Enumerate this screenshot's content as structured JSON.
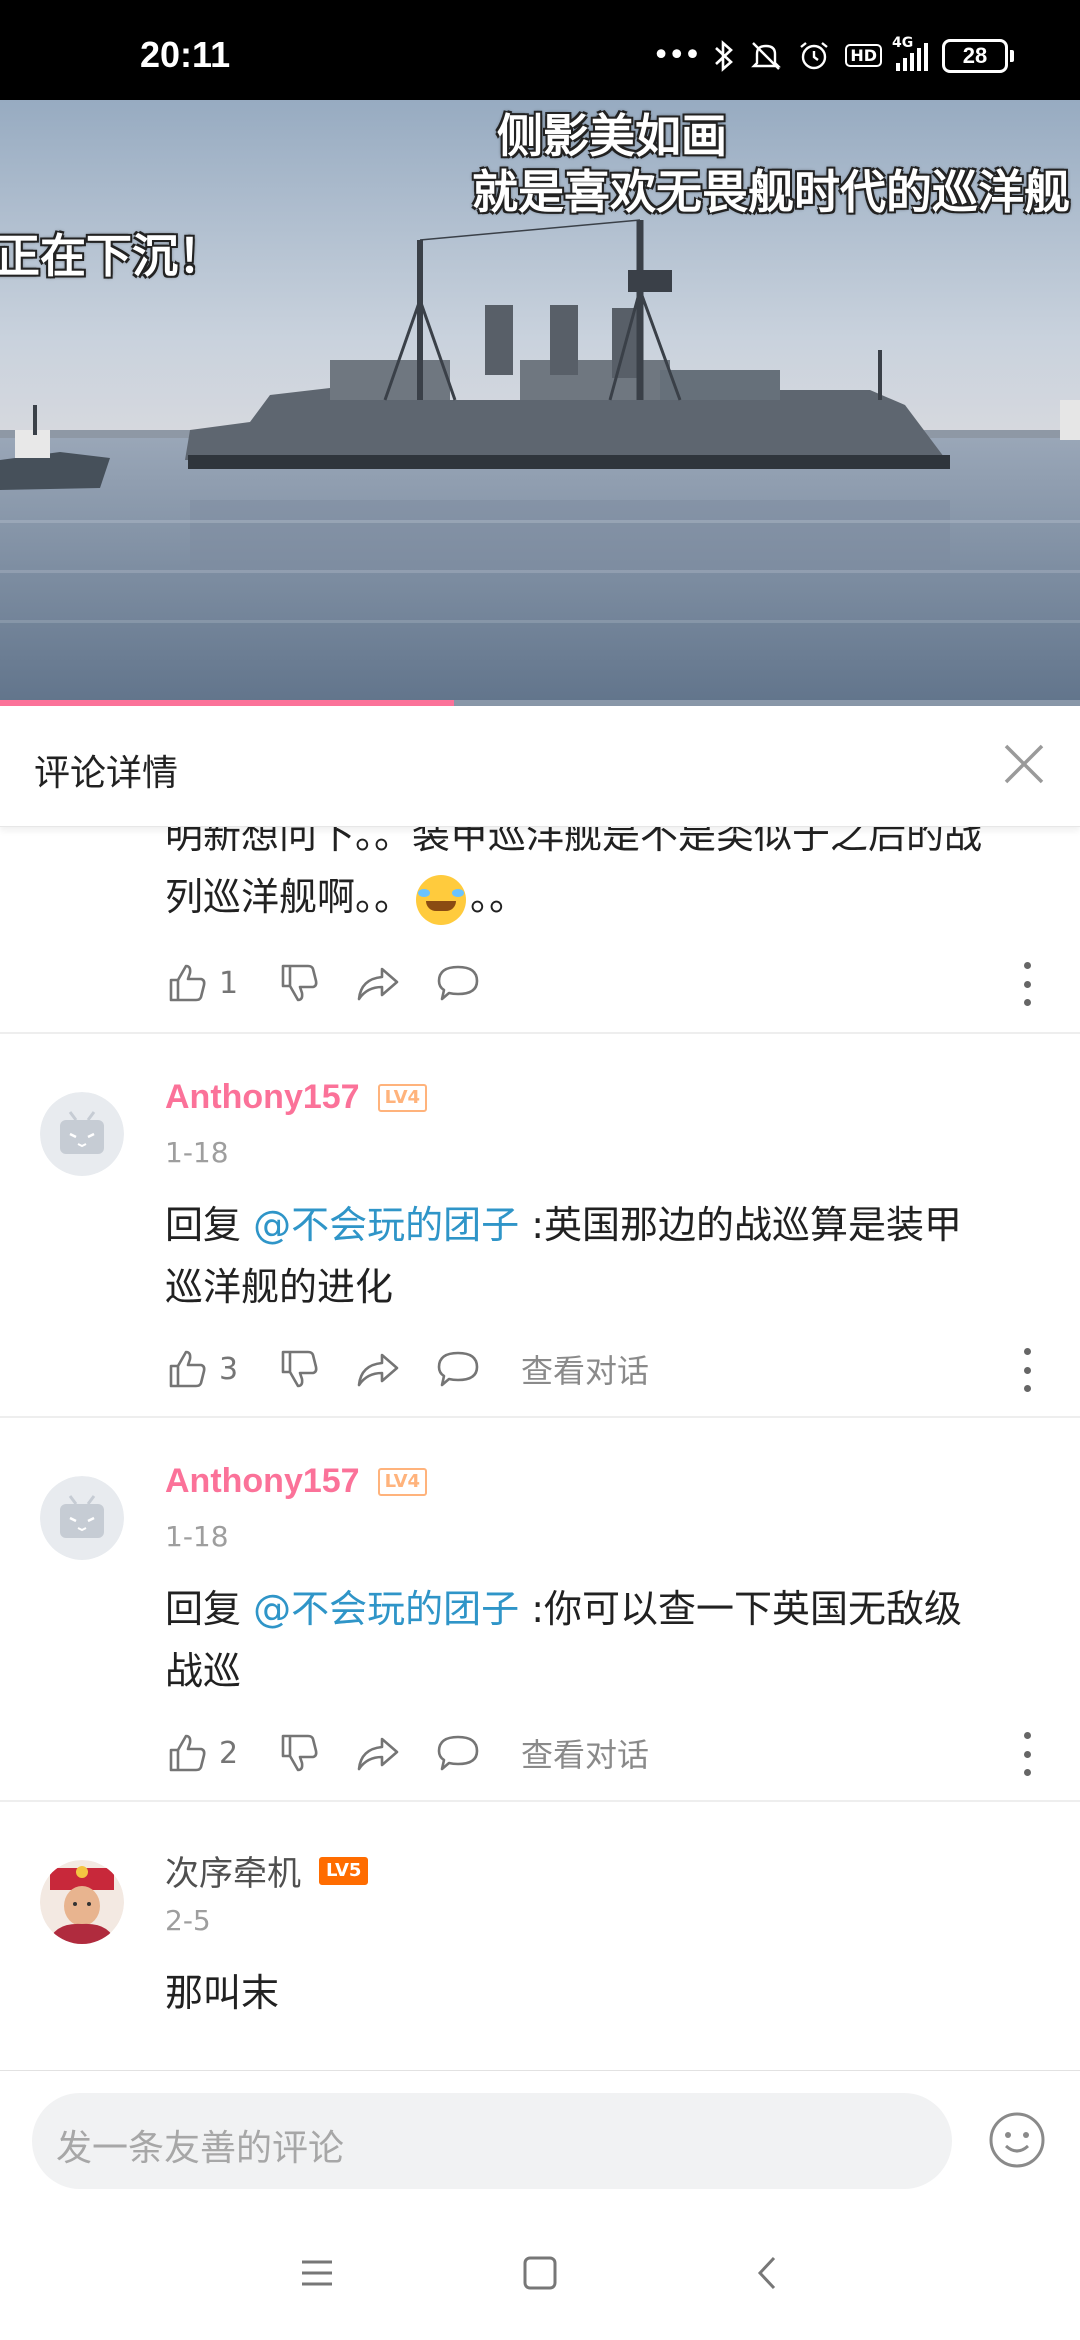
{
  "status_bar": {
    "time": "20:11",
    "network": "4G",
    "hd_badge": "HD",
    "battery": "28",
    "icons": [
      "more-dots-icon",
      "bluetooth-icon",
      "mute-bell-icon",
      "alarm-icon",
      "hd-icon",
      "signal-icon",
      "battery-icon"
    ]
  },
  "video": {
    "danmaku": [
      "侧影美如画",
      "就是喜欢无畏舰时代的巡洋舰",
      "正在下沉！"
    ],
    "progress": 0.42,
    "accent_color": "#fb7299"
  },
  "panel": {
    "title": "评论详情"
  },
  "comments": [
    {
      "text": "明新想问下。。装甲巡洋舰是不是类似于之后的战列巡洋舰啊。。😂。。",
      "text_line1": "明新想问下。。装甲巡洋舰是不是类似于之后的战",
      "text_line2_a": "列巡洋舰啊。。",
      "text_line2_b": "。。",
      "likes": "1"
    },
    {
      "user": "Anthony157",
      "level": "LV4",
      "date": "1-18",
      "reply_prefix": "回复 ",
      "mention": "@不会玩的团子",
      "text_a": " :英国那边的战巡算是装甲",
      "text_b": "巡洋舰的进化",
      "likes": "3",
      "view_conversation": "查看对话"
    },
    {
      "user": "Anthony157",
      "level": "LV4",
      "date": "1-18",
      "reply_prefix": "回复 ",
      "mention": "@不会玩的团子",
      "text_a": " :你可以查一下英国无敌级",
      "text_b": "战巡",
      "likes": "2",
      "view_conversation": "查看对话"
    },
    {
      "user": "次序牵机",
      "level": "LV5",
      "date": "2-5",
      "text": "那叫末"
    }
  ],
  "input": {
    "placeholder": "发一条友善的评论"
  },
  "colors": {
    "username_pink": "#fb7299",
    "mention_blue": "#2f95c8",
    "lv4": "#ffb37c",
    "lv5": "#ff6c00"
  }
}
